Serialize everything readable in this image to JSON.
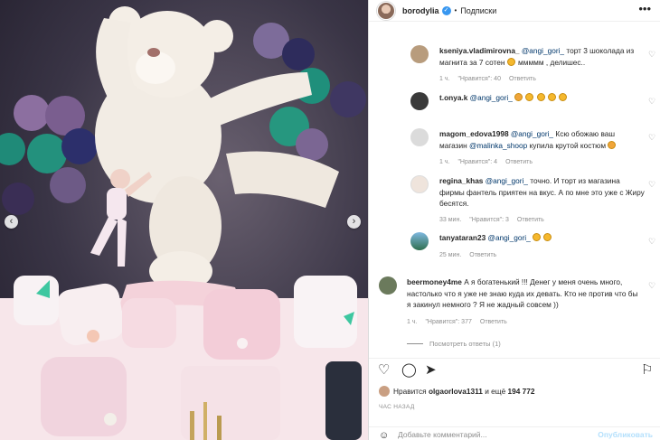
{
  "header": {
    "username": "borodylia",
    "follow_label": "Подписки",
    "more_label": "•••"
  },
  "comments": [
    {
      "user": "kseniya.vladimirovna_",
      "mention": "@angi_gori_",
      "text": "торт 3 шоколада из магнита за 7 сотен",
      "text_after": "ммммм , делишес..",
      "meta_time": "1 ч.",
      "meta_likes": "\"Нравится\": 40",
      "meta_reply": "Ответить",
      "avatar_color": "#b89c7d"
    },
    {
      "user": "t.onya.k",
      "mention": "@angi_gori_",
      "text": "",
      "text_after": "",
      "meta_time": "",
      "meta_likes": "",
      "meta_reply": "",
      "avatar_color": "#3a3a3a"
    },
    {
      "user": "magom_edova1998",
      "mention": "@angi_gori_",
      "text": "Ксю обожаю ваш магазин",
      "mention2": "@malinka_shoop",
      "text_after": "купила крутой костюм",
      "meta_time": "1 ч.",
      "meta_likes": "\"Нравится\": 4",
      "meta_reply": "Ответить",
      "avatar_color": "#dbdbdb"
    },
    {
      "user": "regina_khas",
      "mention": "@angi_gori_",
      "text": "точно. И торт из магазина фирмы фантель приятен на вкус. А по мне это уже с Жиру бесятся.",
      "meta_time": "33 мин.",
      "meta_likes": "\"Нравится\": 3",
      "meta_reply": "Ответить",
      "avatar_color": "#efe4dc"
    },
    {
      "user": "tanyataran23",
      "mention": "@angi_gori_",
      "text": "",
      "meta_time": "25 мин.",
      "meta_likes": "",
      "meta_reply": "Ответить",
      "avatar_color": "#4b8ab8"
    },
    {
      "user": "beermoney4me",
      "text": "А я богатенький !!! Денег у меня очень много, настолько что я уже не знаю куда их девать. Кто не против что бы я закинул немного ? Я не жадный совсем ))",
      "meta_time": "1 ч.",
      "meta_likes": "\"Нравится\": 377",
      "meta_reply": "Ответить",
      "avatar_color": "#6b7a5c"
    }
  ],
  "view_replies_label": "Посмотреть ответы (1)",
  "likes": {
    "prefix": "Нравится",
    "user": "olgaorlova1311",
    "suffix": "и ещё",
    "count": "194 772"
  },
  "post_time": "ЧАС НАЗАД",
  "add_comment": {
    "placeholder": "Добавьте комментарий...",
    "publish_label": "Опубликовать"
  },
  "colors": {
    "link": "#00376b",
    "muted": "#8e8e8e",
    "verified": "#3897f0",
    "publish_disabled": "#b2dffc"
  }
}
